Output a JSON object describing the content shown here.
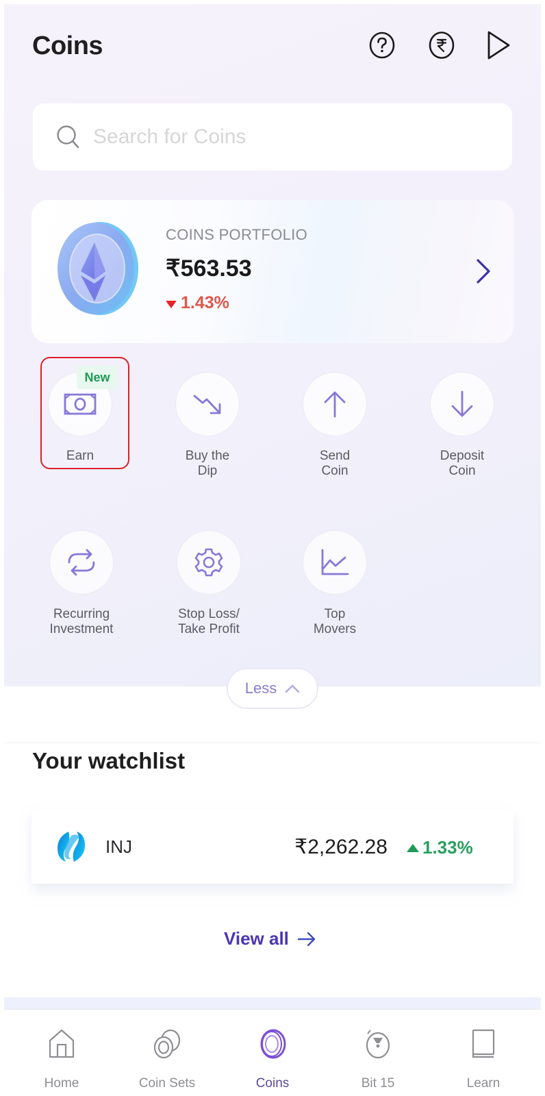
{
  "header": {
    "title": "Coins",
    "icons": [
      "help-icon",
      "rupee-icon",
      "play-icon"
    ]
  },
  "search": {
    "placeholder": "Search for Coins",
    "value": ""
  },
  "portfolio": {
    "label": "COINS PORTFOLIO",
    "value": "₹563.53",
    "change": "1.43%",
    "change_direction": "down",
    "change_color": "#e0574a"
  },
  "actions": [
    {
      "label": "Earn",
      "icon": "money-icon",
      "badge": "New",
      "highlighted": true
    },
    {
      "label": "Buy the\nDip",
      "icon": "trend-down-icon"
    },
    {
      "label": "Send\nCoin",
      "icon": "arrow-up-icon"
    },
    {
      "label": "Deposit\nCoin",
      "icon": "arrow-down-icon"
    },
    {
      "label": "Recurring\nInvestment",
      "icon": "repeat-icon"
    },
    {
      "label": "Stop Loss/\nTake Profit",
      "icon": "gear-icon"
    },
    {
      "label": "Top\nMovers",
      "icon": "line-chart-icon"
    }
  ],
  "less_button": {
    "label": "Less"
  },
  "watchlist": {
    "title": "Your watchlist",
    "items": [
      {
        "symbol": "INJ",
        "price": "₹2,262.28",
        "change": "1.33%",
        "change_direction": "up",
        "change_color": "#28a060"
      }
    ],
    "view_all": "View all"
  },
  "bottom_nav": {
    "active": "Coins",
    "accent_color": "#7b4fd6",
    "items": [
      {
        "label": "Home",
        "icon": "home-icon"
      },
      {
        "label": "Coin Sets",
        "icon": "coin-sets-icon"
      },
      {
        "label": "Coins",
        "icon": "coins-icon"
      },
      {
        "label": "Bit 15",
        "icon": "bit15-icon"
      },
      {
        "label": "Learn",
        "icon": "book-icon"
      }
    ]
  }
}
